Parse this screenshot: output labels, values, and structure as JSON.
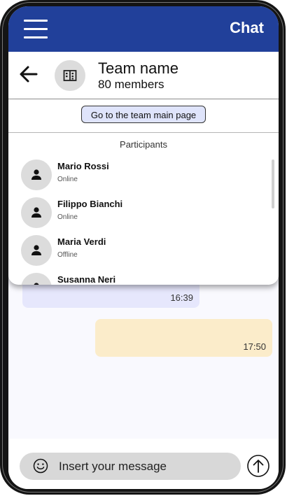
{
  "app": {
    "title": "Chat"
  },
  "team": {
    "name": "Team name",
    "members": "80 members"
  },
  "panel": {
    "goto_label": "Go to the team main page",
    "participants_title": "Participants",
    "participants": [
      {
        "name": "Mario Rossi",
        "status": "Online"
      },
      {
        "name": "Filippo Bianchi",
        "status": "Online"
      },
      {
        "name": "Maria Verdi",
        "status": "Offline"
      },
      {
        "name": "Susanna Neri",
        "status": ""
      }
    ]
  },
  "messages": [
    {
      "direction": "incoming",
      "time": "16:39"
    },
    {
      "direction": "outgoing",
      "time": "17:50"
    }
  ],
  "composer": {
    "placeholder": "Insert your message"
  },
  "icons": {
    "menu": "hamburger-menu-icon",
    "back": "arrow-left-icon",
    "team": "building-icon",
    "person": "person-icon",
    "emoji": "smiley-icon",
    "send": "arrow-up-circle-icon"
  },
  "colors": {
    "header": "#21409a",
    "goto_button": "#dfe4fb",
    "incoming_bubble": "#e6e7fc",
    "outgoing_bubble": "#fbecca"
  }
}
